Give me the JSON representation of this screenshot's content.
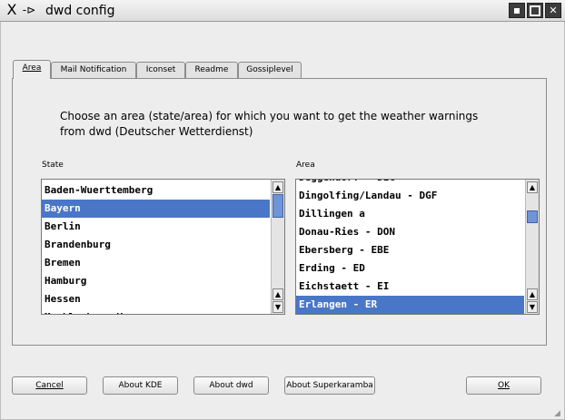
{
  "window": {
    "title": "dwd config",
    "menu_icon": "X",
    "pin_icon": "-⊳"
  },
  "tabs": [
    {
      "label": "Area",
      "active": true
    },
    {
      "label": "Mail Notification",
      "active": false
    },
    {
      "label": "Iconset",
      "active": false
    },
    {
      "label": "Readme",
      "active": false
    },
    {
      "label": "Gossiplevel",
      "active": false
    }
  ],
  "prompt": {
    "line1": "Choose an area (state/area) for which you want to get the weather warnings",
    "line2": "from dwd (Deutscher Wetterdienst)"
  },
  "state_list": {
    "label": "State",
    "items": [
      "Baden-Wuerttemberg",
      "Bayern",
      "Berlin",
      "Brandenburg",
      "Bremen",
      "Hamburg",
      "Hessen",
      "Mecklenburg-Vo"
    ],
    "selected": "Bayern"
  },
  "area_list": {
    "label": "Area",
    "items": [
      "Deggendorf - DEG",
      "Dingolfing/Landau - DGF",
      "Dillingen a",
      "Donau-Ries - DON",
      "Ebersberg - EBE",
      "Erding - ED",
      "Eichstaett - EI",
      "Erlangen - ER"
    ],
    "selected": "Erlangen - ER"
  },
  "buttons": {
    "cancel": "Cancel",
    "about_kde": "About KDE",
    "about_dwd": "About dwd",
    "about_superkaramba": "About Superkaramba",
    "ok": "OK"
  },
  "scroll": {
    "state_position": 0.27,
    "area_position": 0.34
  },
  "colors": {
    "selection": "#4a76c7",
    "scroll_thumb": "#6f95d6"
  }
}
